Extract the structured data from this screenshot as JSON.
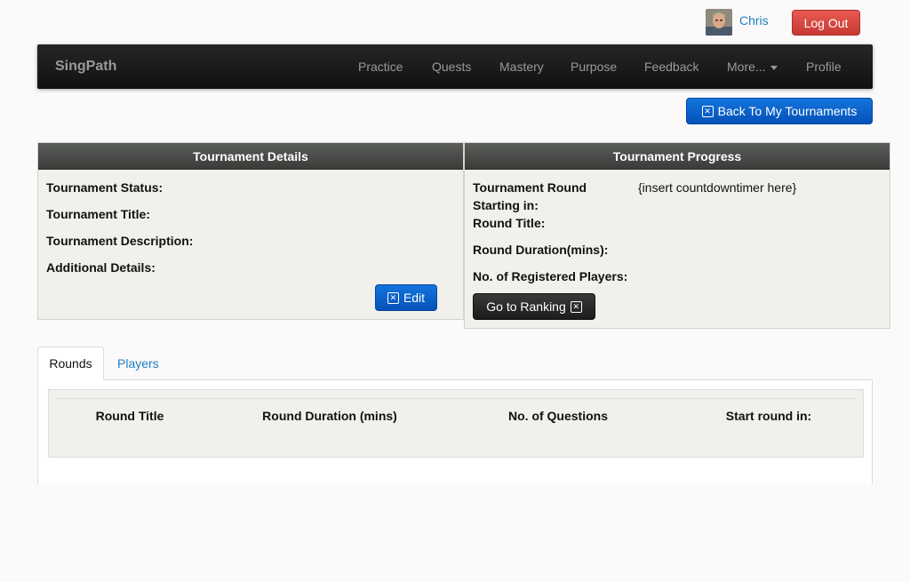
{
  "user": {
    "name": "Chris",
    "logout_label": "Log Out"
  },
  "navbar": {
    "brand": "SingPath",
    "items": [
      "Practice",
      "Quests",
      "Mastery",
      "Purpose",
      "Feedback",
      "More...",
      "Profile"
    ]
  },
  "back_button_label": "Back To My Tournaments",
  "tournament_details": {
    "title": "Tournament Details",
    "fields": [
      "Tournament Status:",
      "Tournament Title:",
      "Tournament Description:",
      "Additional Details:"
    ],
    "edit_label": "Edit"
  },
  "tournament_progress": {
    "title": "Tournament Progress",
    "starting_label_line1": "Tournament Round",
    "starting_label_line2": "Starting in:",
    "countdown_value": "{insert countdowntimer here}",
    "round_title_label": "Round Title:",
    "round_duration_label": "Round Duration(mins):",
    "registered_players_label": "No. of Registered Players:",
    "ranking_label": "Go to Ranking"
  },
  "tabs": {
    "rounds": "Rounds",
    "players": "Players"
  },
  "rounds_table": {
    "headers": [
      "Round Title",
      "Round Duration (mins)",
      "No. of Questions",
      "Start round in:"
    ]
  }
}
